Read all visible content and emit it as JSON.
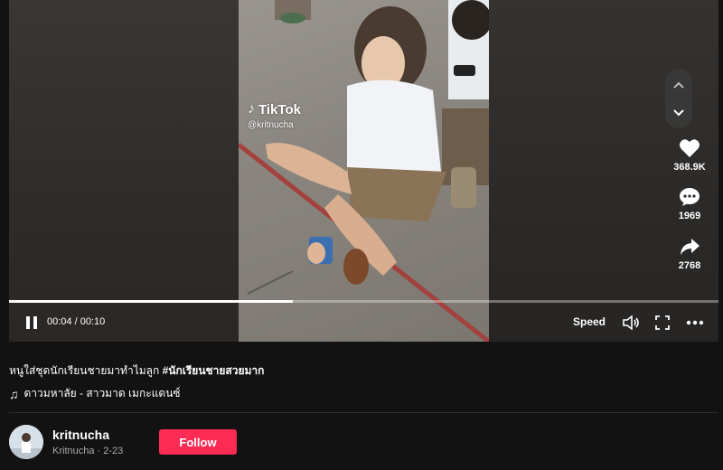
{
  "video": {
    "watermark_brand": "TikTok",
    "watermark_user": "@kritnucha",
    "progress_fraction": 0.4
  },
  "side_actions": {
    "likes": "368.9K",
    "comments": "1969",
    "shares": "2768"
  },
  "controls": {
    "time_text": "00:04 / 00:10",
    "speed_label": "Speed"
  },
  "post": {
    "caption_text": "หนูใส่ชุดนักเรียนชายมาทำไมลูก ",
    "caption_hashtag": "#นักเรียนชายสวยมาก",
    "music_title": "ดาวมหาลัย - สาวมาด เมกะแดนซ์"
  },
  "author": {
    "username": "kritnucha",
    "subline": "Kritnucha · 2-23",
    "follow_label": "Follow"
  },
  "colors": {
    "accent": "#fe2c55",
    "background": "#121212"
  },
  "icons": [
    "chevron-up-icon",
    "chevron-down-icon",
    "heart-icon",
    "comment-icon",
    "share-icon",
    "pause-icon",
    "volume-icon",
    "fullscreen-icon",
    "more-icon",
    "music-note-icon"
  ]
}
